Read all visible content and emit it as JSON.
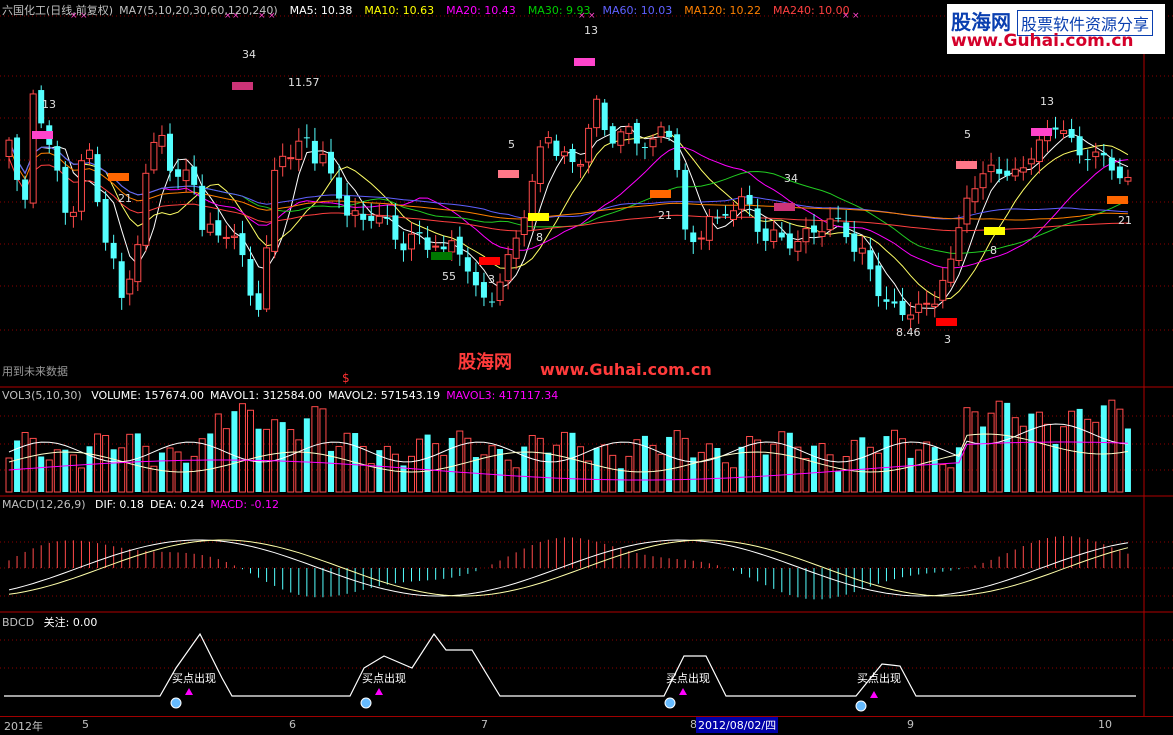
{
  "header": {
    "title": "六国化工(日线,前复权)",
    "ma_set": "MA7(5,10,20,30,60,120,240)",
    "items": [
      {
        "label": "MA5: 10.38",
        "color": "#ffffff"
      },
      {
        "label": "MA10: 10.63",
        "color": "#ffff00"
      },
      {
        "label": "MA20: 10.43",
        "color": "#ff00ff"
      },
      {
        "label": "MA30: 9.93",
        "color": "#00cc00"
      },
      {
        "label": "MA60: 10.03",
        "color": "#6060ff"
      },
      {
        "label": "MA120: 10.22",
        "color": "#ff8000"
      },
      {
        "label": "MA240: 10.00",
        "color": "#ff4040"
      }
    ]
  },
  "brand": {
    "name": "股海网",
    "slogan": "股票软件资源分享",
    "url": "www.Guhai.com.cn"
  },
  "watermark": {
    "name": "股海网",
    "url": "www.Guhai.com.cn"
  },
  "future_data_label": "用到未来数据",
  "dollar_mark": "$",
  "price_annotations": [
    "13",
    "34",
    "11.57",
    "13",
    "5",
    "21",
    "55",
    "3",
    "8",
    "5",
    "21",
    "34",
    "8",
    "13",
    "21",
    "8.46",
    "3"
  ],
  "chart_data": [
    {
      "type": "candlestick",
      "title": "六国化工(日线,前复权)",
      "series": [
        {
          "name": "MA5",
          "last": 10.38
        },
        {
          "name": "MA10",
          "last": 10.63
        },
        {
          "name": "MA20",
          "last": 10.43
        },
        {
          "name": "MA30",
          "last": 9.93
        },
        {
          "name": "MA60",
          "last": 10.03
        },
        {
          "name": "MA120",
          "last": 10.22
        },
        {
          "name": "MA240",
          "last": 10.0
        }
      ],
      "annotations": [
        {
          "text": "11.57",
          "kind": "high"
        },
        {
          "text": "8.46",
          "kind": "low"
        }
      ]
    },
    {
      "type": "bar",
      "title": "VOL3(5,10,30)",
      "series": [
        {
          "name": "VOLUME",
          "last": 157674.0
        },
        {
          "name": "MAVOL1",
          "last": 312584.0
        },
        {
          "name": "MAVOL2",
          "last": 571543.19
        },
        {
          "name": "MAVOL3",
          "last": 417117.34
        }
      ]
    },
    {
      "type": "bar",
      "title": "MACD(12,26,9)",
      "series": [
        {
          "name": "DIF",
          "last": 0.18
        },
        {
          "name": "DEA",
          "last": 0.24
        },
        {
          "name": "MACD",
          "last": -0.12
        }
      ]
    },
    {
      "type": "line",
      "title": "BDCD",
      "series": [
        {
          "name": "关注",
          "last": 0.0
        }
      ],
      "signals": [
        "买点出现",
        "买点出现",
        "买点出现",
        "买点出现"
      ]
    }
  ],
  "panels": {
    "vol": {
      "title": "VOL3(5,10,30)",
      "items": [
        {
          "label": "VOLUME: 157674.00",
          "color": "#ffffff"
        },
        {
          "label": "MAVOL1: 312584.00",
          "color": "#ffffff"
        },
        {
          "label": "MAVOL2: 571543.19",
          "color": "#ffffff"
        },
        {
          "label": "MAVOL3: 417117.34",
          "color": "#ff00ff"
        }
      ]
    },
    "macd": {
      "title": "MACD(12,26,9)",
      "items": [
        {
          "label": "DIF: 0.18",
          "color": "#ffffff"
        },
        {
          "label": "DEA: 0.24",
          "color": "#ffffff"
        },
        {
          "label": "MACD: -0.12",
          "color": "#ff00ff"
        }
      ]
    },
    "bdcd": {
      "title": "BDCD",
      "items": [
        {
          "label": "关注: 0.00",
          "color": "#ffffff"
        }
      ]
    }
  },
  "signal_label": "买点出现",
  "timeline": {
    "year": "2012年",
    "months": [
      "5",
      "6",
      "7",
      "8",
      "9",
      "10"
    ],
    "cursor_date": "2012/08/02/四"
  },
  "colors": {
    "up": "#ff4a4a",
    "down": "#54ffff",
    "grid": "#8b0000",
    "bg": "#000000"
  }
}
